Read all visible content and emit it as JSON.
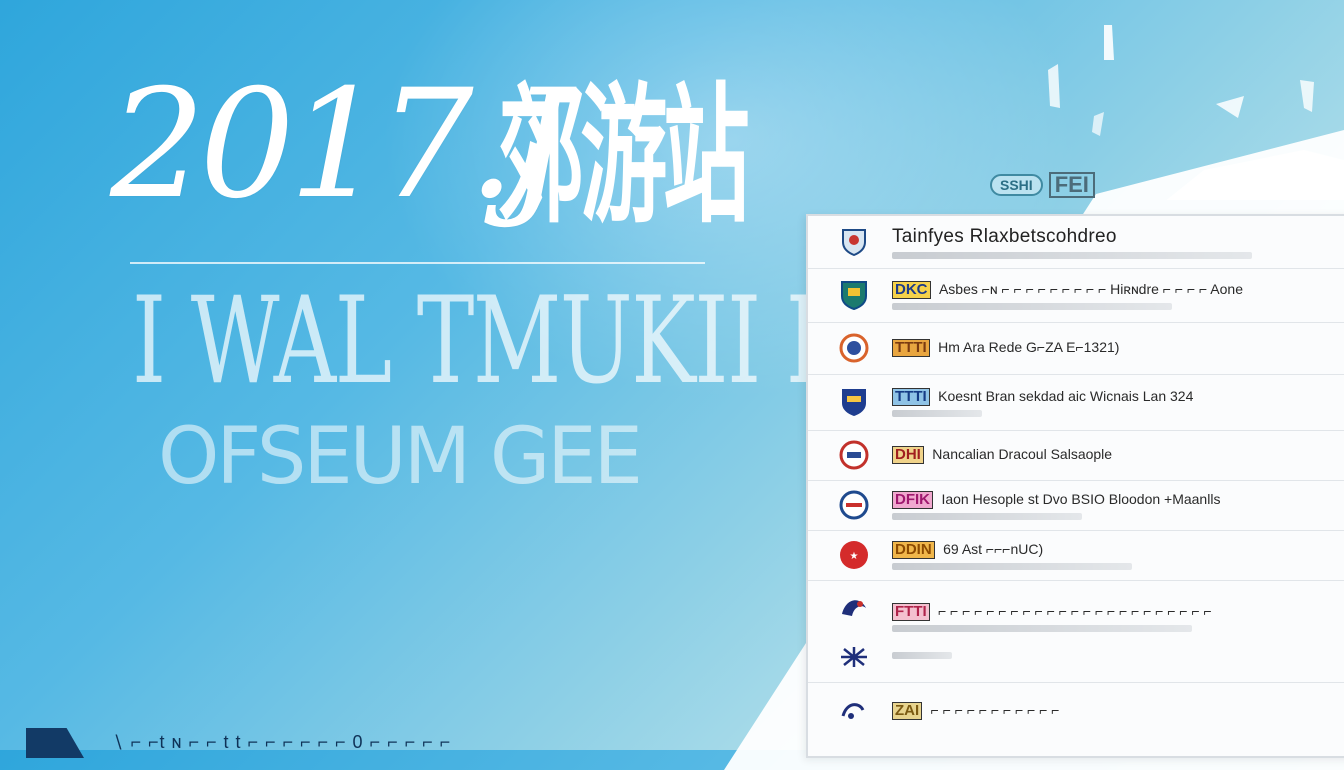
{
  "hero": {
    "year": "2017.J",
    "cn_title": "郊游站",
    "mid_text": "I WAL TMUKII I",
    "low_text": "OFSEUM GEE"
  },
  "footer": {
    "text": "∖ ⌐ ⌐t ɴ ⌐ ⌐ t t ⌐ ⌐ ⌐ ⌐ ⌐ ⌐ 0 ⌐ ⌐ ⌐ ⌐ ⌐"
  },
  "badge": {
    "pill": "SSHI",
    "tag": "FEI"
  },
  "panel": {
    "header": "Tainfyes Rlaxbetscohdreo",
    "rows": [
      {
        "code": "DKC",
        "text": "Asbes ⌐ɴ ⌐ ⌐ ⌐ ⌐ ⌐ ⌐ ⌐ ⌐ ⌐ Hiʀɴdre ⌐ ⌐ ⌐ ⌐ Aone"
      },
      {
        "code": "TTTI",
        "text": "Hm Ara Rede G⌐ZA E⌐1321)"
      },
      {
        "code": "TTTI",
        "text": "Koesnt Bran sekdad aic Wicnais Lan 324"
      },
      {
        "code": "DHI",
        "text": "Nancalian Dracoul Salsaople"
      },
      {
        "code": "DFIK",
        "text": "Iaon Hesople st Dvo BSIO Bloodon +Maanlls"
      },
      {
        "code": "DDIN",
        "text": "69 Ast ⌐⌐⌐nUC)"
      },
      {
        "code": "FTTI",
        "text": "⌐ ⌐ ⌐ ⌐ ⌐ ⌐ ⌐ ⌐ ⌐ ⌐ ⌐ ⌐ ⌐ ⌐ ⌐ ⌐ ⌐ ⌐ ⌐ ⌐ ⌐ ⌐ ⌐"
      },
      {
        "code": "ZAI",
        "text": "⌐ ⌐ ⌐ ⌐ ⌐ ⌐ ⌐ ⌐ ⌐ ⌐ ⌐"
      }
    ]
  },
  "colors": {
    "bg_start": "#2fa6dc",
    "bg_end": "#d8eef0",
    "hero_text": "#ffffff",
    "panel_bg": "#fbfcfd"
  }
}
